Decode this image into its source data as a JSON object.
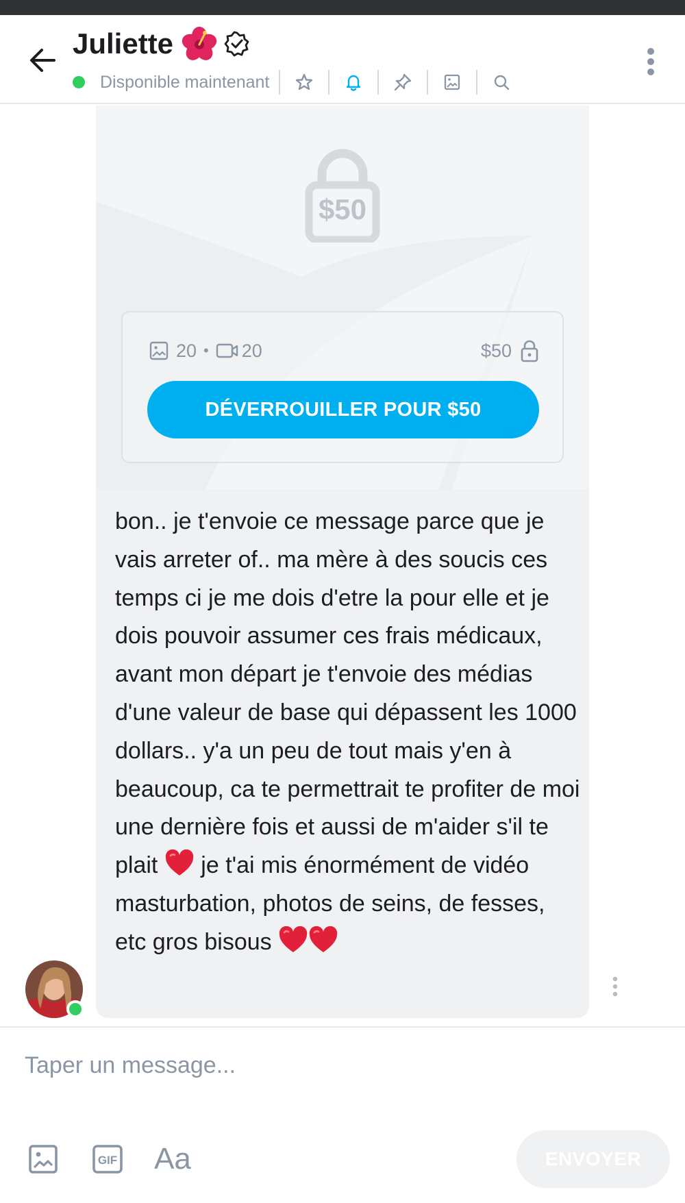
{
  "header": {
    "title": "Juliette",
    "title_emoji": "hibiscus-emoji",
    "verified_icon": "verified-badge-icon",
    "status": "Disponible maintenant",
    "icons": [
      "star-icon",
      "bell-icon",
      "pin-icon",
      "image-icon",
      "search-icon"
    ],
    "accent": "#00aff0"
  },
  "locked_post": {
    "lock_price": "$50",
    "photos_count": "20",
    "videos_count": "20",
    "separator": "•",
    "price": "$50",
    "unlock_label": "DÉVERROUILLER POUR $50"
  },
  "message": {
    "text": "bon.. je t'envoie ce message parce que je vais arreter of.. ma mère à des soucis ces temps ci je me dois d'etre la pour elle et je dois pouvoir assumer ces frais médicaux, avant mon départ je t'envoie des médias d'une valeur de base qui dépassent les 1000 dollars.. y'a un peu de tout mais y'en à beaucoup, ca te permettrait te profiter de moi une dernière fois et aussi de m'aider s'il te plait",
    "text_2": "je t'ai mis énormément de vidéo masturbation, photos de seins, de fesses, etc gros bisous"
  },
  "composer": {
    "placeholder": "Taper un message...",
    "send_label": "ENVOYER",
    "aa_label": "Aa",
    "gif_label": "GIF"
  },
  "colors": {
    "brand": "#00aff0",
    "online": "#2fce5e",
    "muted": "#8a96a3",
    "bubble": "#f0f1f3"
  }
}
